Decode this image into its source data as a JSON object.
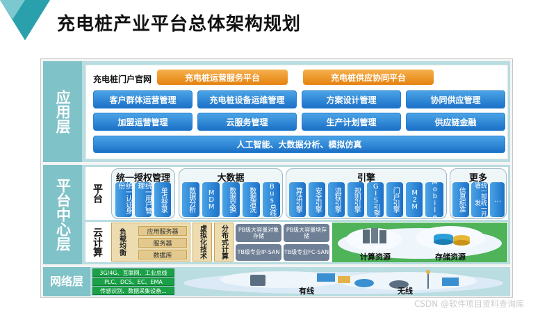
{
  "title": "充电桩产业平台总体架构规划",
  "application_layer": {
    "label": "应用层",
    "portal": "充电桩门户官网",
    "top_platforms": [
      "充电桩运营服务平台",
      "充电桩供应协同平台"
    ],
    "row1": [
      "客户群体运营管理",
      "充电桩设备运维管理",
      "方案设计管理",
      "协同供应管理"
    ],
    "row2": [
      "加盟运营管理",
      "云服务管理",
      "生产计划管理",
      "供应链金融"
    ],
    "ai_bar": "人工智能、大数据分析、模拟仿真"
  },
  "platform_center": {
    "label": "平台中心层",
    "platform_label": "平台",
    "groups": [
      {
        "title": "统一授权管理",
        "items": [
          "统一认证身份",
          "统一用户管理",
          "单点登录"
        ]
      },
      {
        "title": "大数据",
        "items": [
          "数据分析",
          "MDM",
          "数据交换",
          "数据清洗",
          "Bus总线"
        ]
      },
      {
        "title": "引擎",
        "items": [
          "算法引擎",
          "安全引擎",
          "流程引擎",
          "规则引擎",
          "GIS引擎",
          "门户引擎",
          "M2M",
          "Mobile"
        ]
      },
      {
        "title": "更多",
        "items": [
          "信息标准",
          "统一部署",
          "统一开发",
          "…"
        ]
      }
    ],
    "cloud_label": "云计算",
    "load_balance": "负载均衡",
    "servers": [
      "应用服务器",
      "服务器",
      "数据库"
    ],
    "virtualization": "虚拟化技术",
    "distributed": "分布式计算",
    "storage": [
      "PB级大容量对象存储",
      "PB级大容量块存储",
      "TB级专业IP-SAN",
      "TB级专业FC-SAN"
    ],
    "compute_resources": "计算资源",
    "storage_resources": "存储资源"
  },
  "network_layer": {
    "label": "网络层",
    "items": [
      "3G/4G、互联网、工业总线",
      "PLC、DCS、EC、EMA",
      "传感识别、数据采集设备..."
    ],
    "wired": "有线",
    "wireless": "无线"
  },
  "watermark": "CSDN @软件项目资料查询库",
  "colors": {
    "teal_band": "#b9dde0",
    "teal_label": "#7fc2c8",
    "blue": "#1c71c8",
    "orange": "#e5820f",
    "green": "#1aa148",
    "tan": "#e3c98d"
  }
}
